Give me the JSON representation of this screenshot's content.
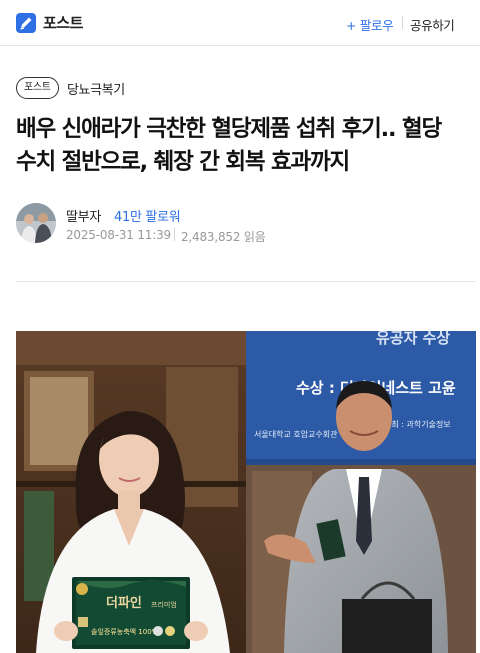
{
  "header": {
    "logo_text": "포스트",
    "follow_label": "+ 팔로우",
    "share_label": "공유하기"
  },
  "article": {
    "tag": "포스트",
    "category": "당뇨극복기",
    "title_line1": "배우 신애라가 극찬한 혈당제품 섭취 후기.. 혈당",
    "title_line2": "수치 절반으로, 췌장 간 회복 효과까지",
    "author": "딸부자",
    "followers": "41만 팔로워",
    "date": "2025-08-31 11:39",
    "reads": "2,483,852 읽음"
  },
  "photo": {
    "banner_line1": "유공자 수상",
    "banner_award": "수상 : 더파인네스트 고윤",
    "banner_line2": "서울대학교 호암교수회관",
    "banner_host": "주최 : 과학기술정보",
    "product_name": "더파인",
    "product_sub": "프리미엄",
    "product_desc": "솔잎증류농축액 100%"
  },
  "colors": {
    "accent": "#2f6fe4",
    "banner": "#2d5aa6"
  }
}
